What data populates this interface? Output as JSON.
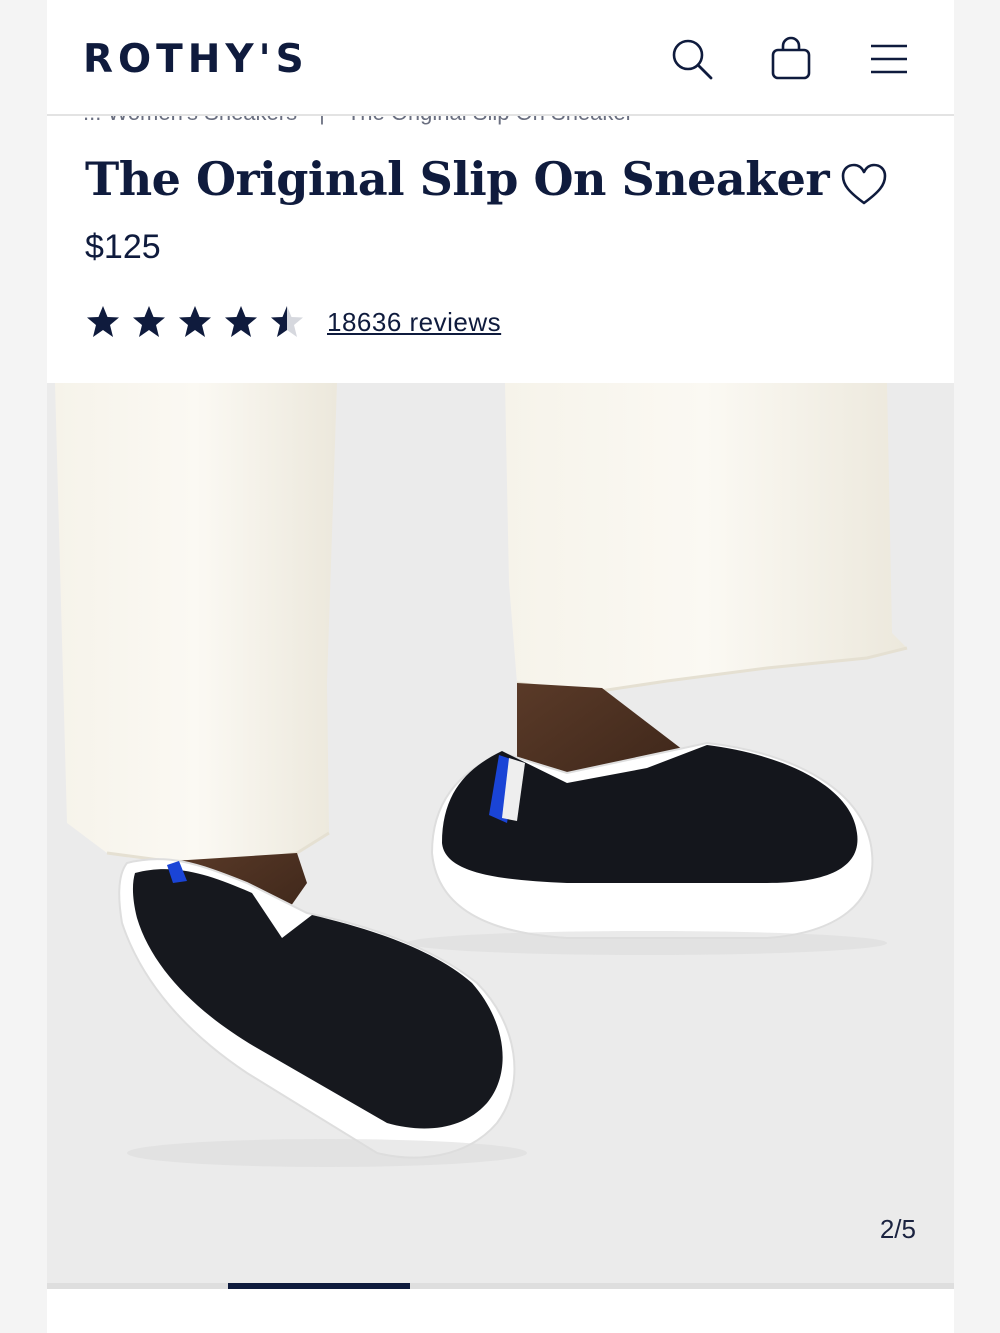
{
  "header": {
    "logo": "ROTHY'S",
    "icons": [
      "search-icon",
      "bag-icon",
      "menu-icon"
    ]
  },
  "breadcrumb": {
    "items": [
      "... Women's Sneakers",
      "The Original Slip On Sneaker"
    ],
    "separator": "|"
  },
  "product": {
    "title": "The Original Slip On Sneaker",
    "price": "$125",
    "rating": 4.5,
    "rating_max": 5,
    "reviews_label": "18636 reviews"
  },
  "gallery": {
    "counter": "2/5",
    "current": 2,
    "total": 5
  },
  "colors": {
    "navy": "#0f1b3d",
    "accent_blue": "#1a44d6"
  }
}
